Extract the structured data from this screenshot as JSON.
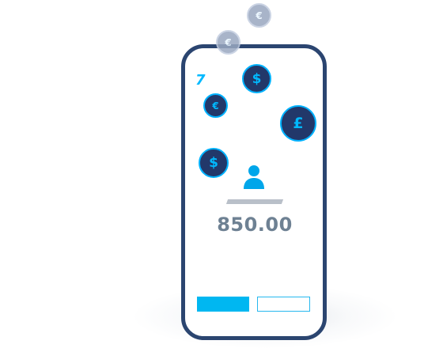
{
  "brand": {
    "logo_glyph": "7",
    "accent_color": "#00b9ff",
    "phone_frame_color": "#2b4570"
  },
  "coins": [
    {
      "name": "coin-euro-faded-top",
      "symbol": "€",
      "style": "faded"
    },
    {
      "name": "coin-euro-faded",
      "symbol": "€",
      "style": "faded"
    },
    {
      "name": "coin-dollar-top",
      "symbol": "$",
      "style": "dark"
    },
    {
      "name": "coin-euro",
      "symbol": "€",
      "style": "dark"
    },
    {
      "name": "coin-pound",
      "symbol": "£",
      "style": "dark"
    },
    {
      "name": "coin-dollar-left",
      "symbol": "$",
      "style": "dark"
    }
  ],
  "recipient": {
    "icon": "user-icon"
  },
  "amount": "850.00",
  "buttons": {
    "primary_label": "",
    "secondary_label": ""
  }
}
